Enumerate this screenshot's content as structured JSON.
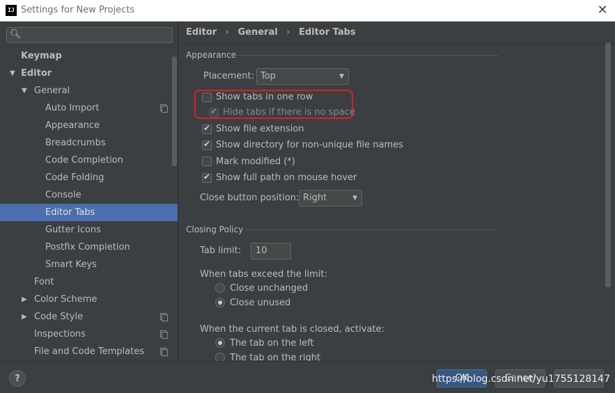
{
  "window": {
    "app_icon_text": "IJ",
    "title": "Settings for New Projects",
    "close_glyph": "✕"
  },
  "search": {
    "value": "",
    "icon": "search-icon"
  },
  "tree": [
    {
      "label": "Keymap",
      "bold": true,
      "indent": 0,
      "arrow": "",
      "copy_icon": false
    },
    {
      "label": "Editor",
      "bold": true,
      "indent": 0,
      "arrow": "▼",
      "copy_icon": false
    },
    {
      "label": "General",
      "bold": false,
      "indent": 1,
      "arrow": "▼",
      "copy_icon": false
    },
    {
      "label": "Auto Import",
      "bold": false,
      "indent": 2,
      "arrow": "",
      "copy_icon": true
    },
    {
      "label": "Appearance",
      "bold": false,
      "indent": 2,
      "arrow": "",
      "copy_icon": false
    },
    {
      "label": "Breadcrumbs",
      "bold": false,
      "indent": 2,
      "arrow": "",
      "copy_icon": false
    },
    {
      "label": "Code Completion",
      "bold": false,
      "indent": 2,
      "arrow": "",
      "copy_icon": false
    },
    {
      "label": "Code Folding",
      "bold": false,
      "indent": 2,
      "arrow": "",
      "copy_icon": false
    },
    {
      "label": "Console",
      "bold": false,
      "indent": 2,
      "arrow": "",
      "copy_icon": false
    },
    {
      "label": "Editor Tabs",
      "bold": false,
      "indent": 2,
      "arrow": "",
      "copy_icon": false,
      "selected": true
    },
    {
      "label": "Gutter Icons",
      "bold": false,
      "indent": 2,
      "arrow": "",
      "copy_icon": false
    },
    {
      "label": "Postfix Completion",
      "bold": false,
      "indent": 2,
      "arrow": "",
      "copy_icon": false
    },
    {
      "label": "Smart Keys",
      "bold": false,
      "indent": 2,
      "arrow": "",
      "copy_icon": false
    },
    {
      "label": "Font",
      "bold": false,
      "indent": 1,
      "arrow": "",
      "copy_icon": false
    },
    {
      "label": "Color Scheme",
      "bold": false,
      "indent": 1,
      "arrow": "▶",
      "copy_icon": false
    },
    {
      "label": "Code Style",
      "bold": false,
      "indent": 1,
      "arrow": "▶",
      "copy_icon": true
    },
    {
      "label": "Inspections",
      "bold": false,
      "indent": 1,
      "arrow": "",
      "copy_icon": true
    },
    {
      "label": "File and Code Templates",
      "bold": false,
      "indent": 1,
      "arrow": "",
      "copy_icon": true
    }
  ],
  "breadcrumb": {
    "parts": [
      "Editor",
      "General",
      "Editor Tabs"
    ],
    "separator": "›"
  },
  "appearance": {
    "title": "Appearance",
    "placement_label": "Placement:",
    "placement_value": "Top",
    "show_tabs_one_row": {
      "label": "Show tabs in one row",
      "checked": false
    },
    "hide_tabs_no_space": {
      "label": "Hide tabs if there is no space",
      "checked": true,
      "disabled": true
    },
    "show_file_extension": {
      "label": "Show file extension",
      "checked": true
    },
    "show_directory": {
      "label": "Show directory for non-unique file names",
      "checked": true
    },
    "mark_modified": {
      "label": "Mark modified (*)",
      "checked": false
    },
    "show_full_path": {
      "label": "Show full path on mouse hover",
      "checked": true
    },
    "close_button_label": "Close button position:",
    "close_button_value": "Right"
  },
  "closing": {
    "title": "Closing Policy",
    "tab_limit_label": "Tab limit:",
    "tab_limit_value": "10",
    "exceed_label": "When tabs exceed the limit:",
    "close_unchanged": {
      "label": "Close unchanged",
      "selected": false
    },
    "close_unused": {
      "label": "Close unused",
      "selected": true
    },
    "activate_label": "When the current tab is closed, activate:",
    "tab_left": {
      "label": "The tab on the left",
      "selected": true
    },
    "tab_right": {
      "label": "The tab on the right",
      "selected": false
    }
  },
  "buttons": {
    "help": "?",
    "ok": "OK",
    "cancel": "Cancel",
    "apply": ""
  },
  "watermark": "https://blog.csdn.net/yu1755128147",
  "colors": {
    "selection": "#4b6eaf",
    "background": "#3c3f41",
    "highlight_border": "#d62222",
    "primary_button": "#365880"
  }
}
